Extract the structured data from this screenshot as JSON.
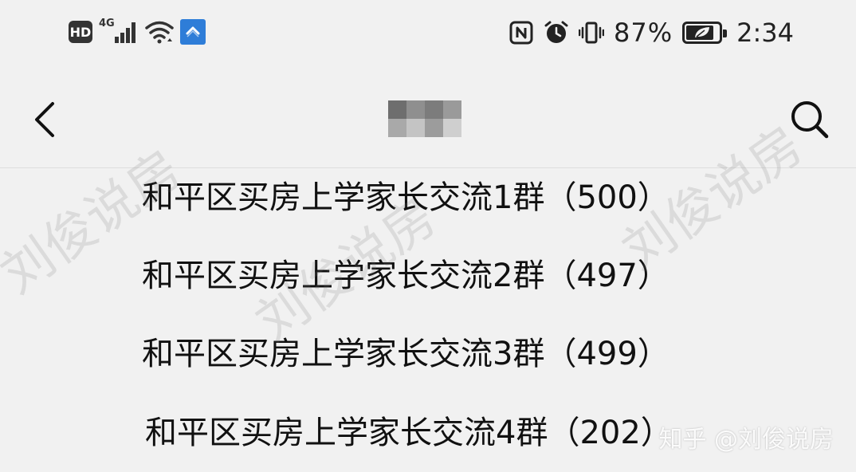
{
  "status_bar": {
    "hd_label": "HD",
    "network_label": "4G",
    "battery_percent": "87%",
    "battery_level": 0.87,
    "time": "2:34",
    "icons": [
      "hd-icon",
      "signal-4g-icon",
      "wifi-icon",
      "vpn-icon",
      "nfc-icon",
      "alarm-icon",
      "vibrate-icon",
      "battery-icon"
    ]
  },
  "nav": {
    "back_icon": "chevron-left-icon",
    "title": "",
    "search_icon": "search-icon"
  },
  "groups": [
    {
      "name": "和平区买房上学家长交流1群",
      "count": "（500）"
    },
    {
      "name": "和平区买房上学家长交流2群",
      "count": "（497）"
    },
    {
      "name": "和平区买房上学家长交流3群",
      "count": "（499）"
    },
    {
      "name": "和平区买房上学家长交流4群",
      "count": "（202）"
    }
  ],
  "watermarks": {
    "diagonal": "刘俊说房",
    "footer": "知乎 @刘俊说房"
  },
  "colors": {
    "background": "#f1f1f1",
    "vpn_blue": "#2e7dd8",
    "text": "#111111"
  }
}
